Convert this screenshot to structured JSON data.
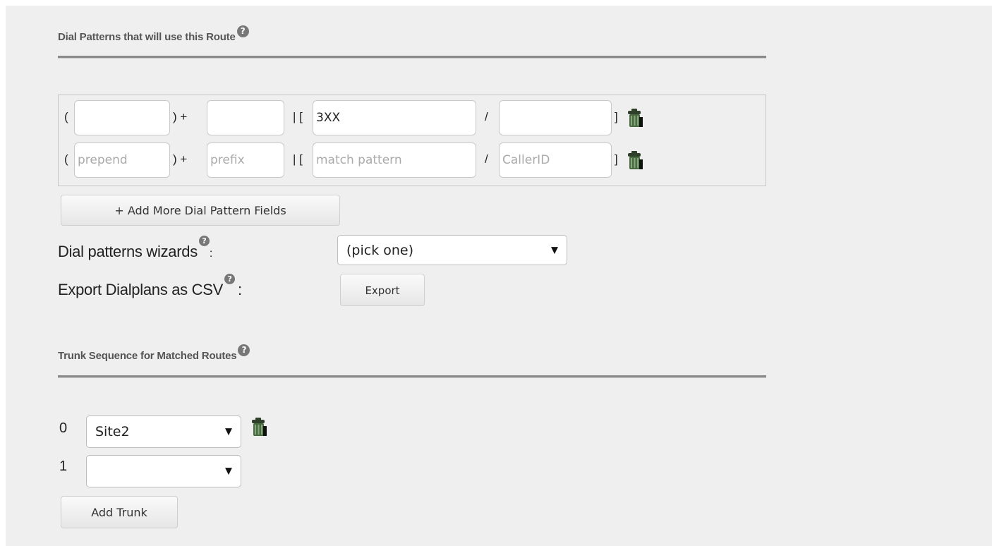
{
  "dial_patterns": {
    "title": "Dial Patterns that will use this Route",
    "help_glyph": "?",
    "rows": [
      {
        "open_paren": "(",
        "plus": ") +",
        "pipe": "| [",
        "slash": "/",
        "close_bracket": "]",
        "prepend": "",
        "prefix": "",
        "match_pattern": "3XX",
        "caller_id": "",
        "prepend_placeholder": "",
        "prefix_placeholder": "",
        "match_placeholder": "",
        "callerid_placeholder": ""
      },
      {
        "open_paren": "(",
        "plus": ") +",
        "pipe": "| [",
        "slash": "/",
        "close_bracket": "]",
        "prepend": "",
        "prefix": "",
        "match_pattern": "",
        "caller_id": "",
        "prepend_placeholder": "prepend",
        "prefix_placeholder": "prefix",
        "match_placeholder": "match pattern",
        "callerid_placeholder": "CallerID"
      }
    ],
    "add_more_label": "+ Add More Dial Pattern Fields"
  },
  "wizards": {
    "label": "Dial patterns wizards",
    "colon": ":",
    "selected": "(pick one)"
  },
  "export": {
    "label": "Export Dialplans as CSV",
    "colon": ":",
    "button_label": "Export"
  },
  "trunk_sequence": {
    "title": "Trunk Sequence for Matched Routes",
    "help_glyph": "?",
    "rows": [
      {
        "index": "0",
        "selected": "Site2"
      },
      {
        "index": "1",
        "selected": ""
      }
    ],
    "add_trunk_label": "Add Trunk"
  },
  "icons": {
    "help": "help-icon",
    "trash": "trash-icon",
    "caret": "chevron-down-icon"
  },
  "colors": {
    "panel_bg": "#efefef",
    "rule": "#8a8a8a",
    "trash_green": "#3f5a3a"
  }
}
